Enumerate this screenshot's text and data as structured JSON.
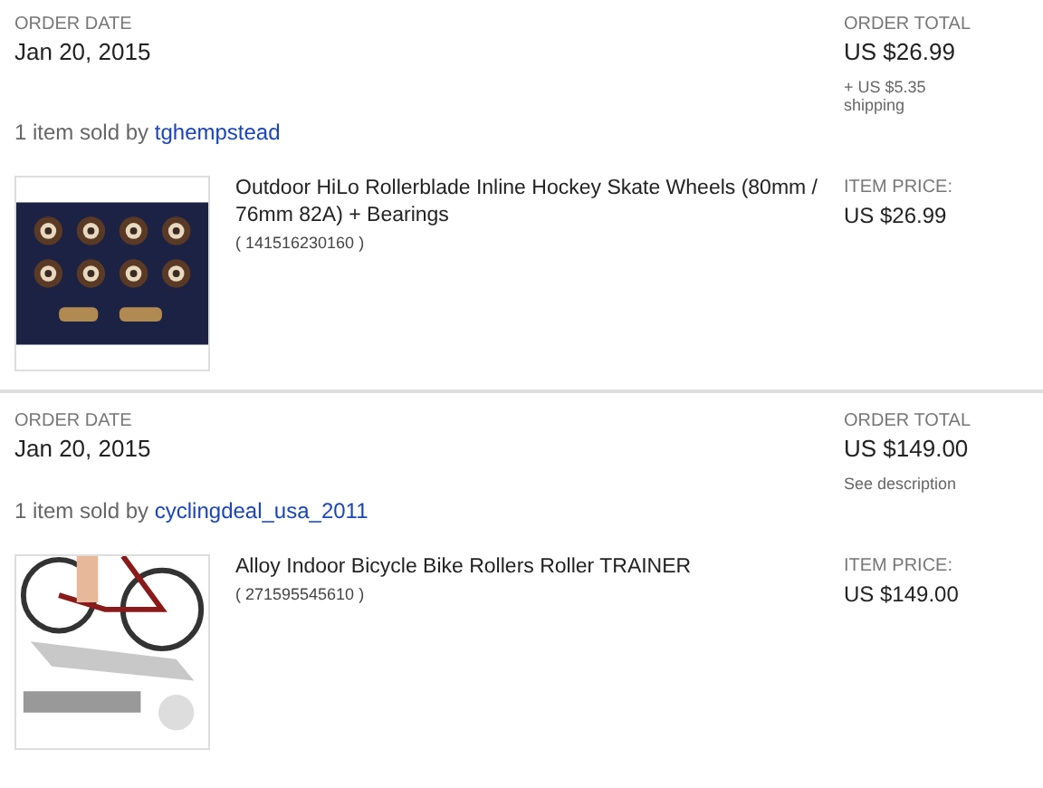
{
  "orders": [
    {
      "date_label": "ORDER DATE",
      "date": "Jan 20, 2015",
      "total_label": "ORDER TOTAL",
      "total": "US $26.99",
      "total_note": "+ US $5.35 shipping",
      "sold_by": "1 item sold by",
      "seller": "tghempstead",
      "item": {
        "title": "Outdoor HiLo Rollerblade Inline Hockey Skate Wheels (80mm / 76mm 82A) + Bearings",
        "number": "( 141516230160 )",
        "price_label": "ITEM PRICE:",
        "price": "US $26.99"
      }
    },
    {
      "date_label": "ORDER DATE",
      "date": "Jan 20, 2015",
      "total_label": "ORDER TOTAL",
      "total": "US $149.00",
      "total_note": "See description",
      "sold_by": "1 item sold by",
      "seller": "cyclingdeal_usa_2011",
      "item": {
        "title": "Alloy Indoor Bicycle Bike Rollers Roller TRAINER",
        "number": "( 271595545610 )",
        "price_label": "ITEM PRICE:",
        "price": "US $149.00"
      }
    }
  ]
}
